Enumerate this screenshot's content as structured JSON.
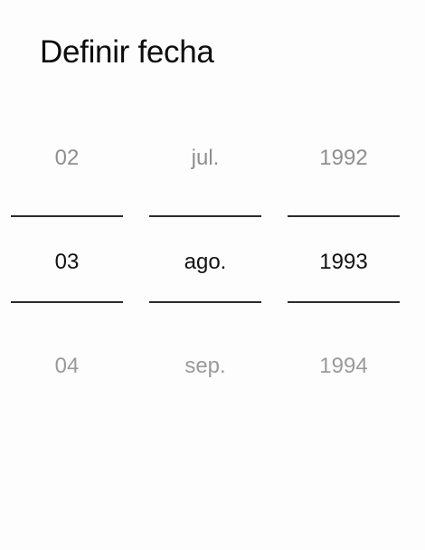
{
  "dialog": {
    "title": "Definir fecha"
  },
  "pickers": {
    "day": {
      "prev": "02",
      "selected": "03",
      "next": "04"
    },
    "month": {
      "prev": "jul.",
      "selected": "ago.",
      "next": "sep."
    },
    "year": {
      "prev": "1992",
      "selected": "1993",
      "next": "1994"
    }
  }
}
